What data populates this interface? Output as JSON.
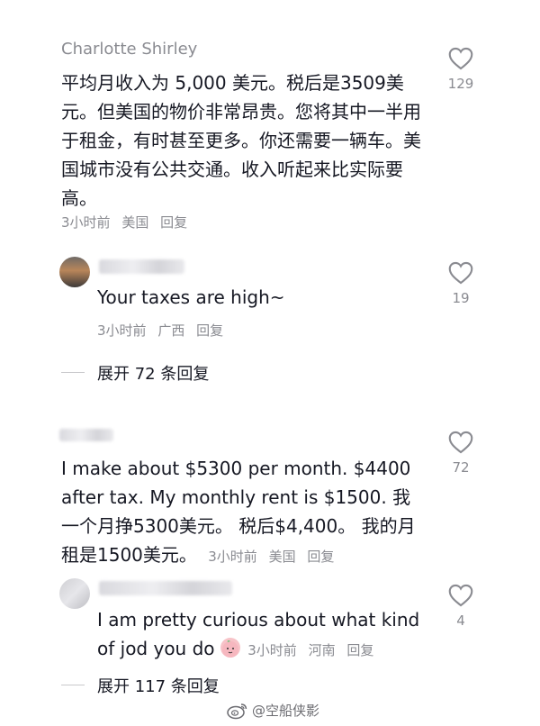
{
  "comments": [
    {
      "username": "Charlotte Shirley",
      "text": "平均月收入为 5,000 美元。税后是3509美元。但美国的物价非常昂贵。您将其中一半用于租金，有时甚至更多。你还需要一辆车。美国城市没有公共交通。收入听起来比实际要高。",
      "time": "3小时前",
      "location": "美国",
      "reply_label": "回复",
      "likes": "129"
    },
    {
      "text": "Your taxes are high~",
      "time": "3小时前",
      "location": "广西",
      "reply_label": "回复",
      "likes": "19",
      "expand_label": "展开 72 条回复"
    },
    {
      "text": "I make about $5300 per month. $4400 after tax. My monthly rent is $1500. 我一个月挣5300美元。 税后$4,400。 我的月租是1500美元。",
      "time": "3小时前",
      "location": "美国",
      "reply_label": "回复",
      "likes": "72"
    },
    {
      "text": "I am pretty curious about what kind of jod you do",
      "time": "3小时前",
      "location": "河南",
      "reply_label": "回复",
      "likes": "4",
      "expand_label": "展开 117 条回复"
    }
  ],
  "watermark": "@空船侠影",
  "icons": {
    "like": "heart-outline-icon",
    "weibo": "weibo-logo-icon",
    "emoji": "peach-emoji-icon"
  }
}
